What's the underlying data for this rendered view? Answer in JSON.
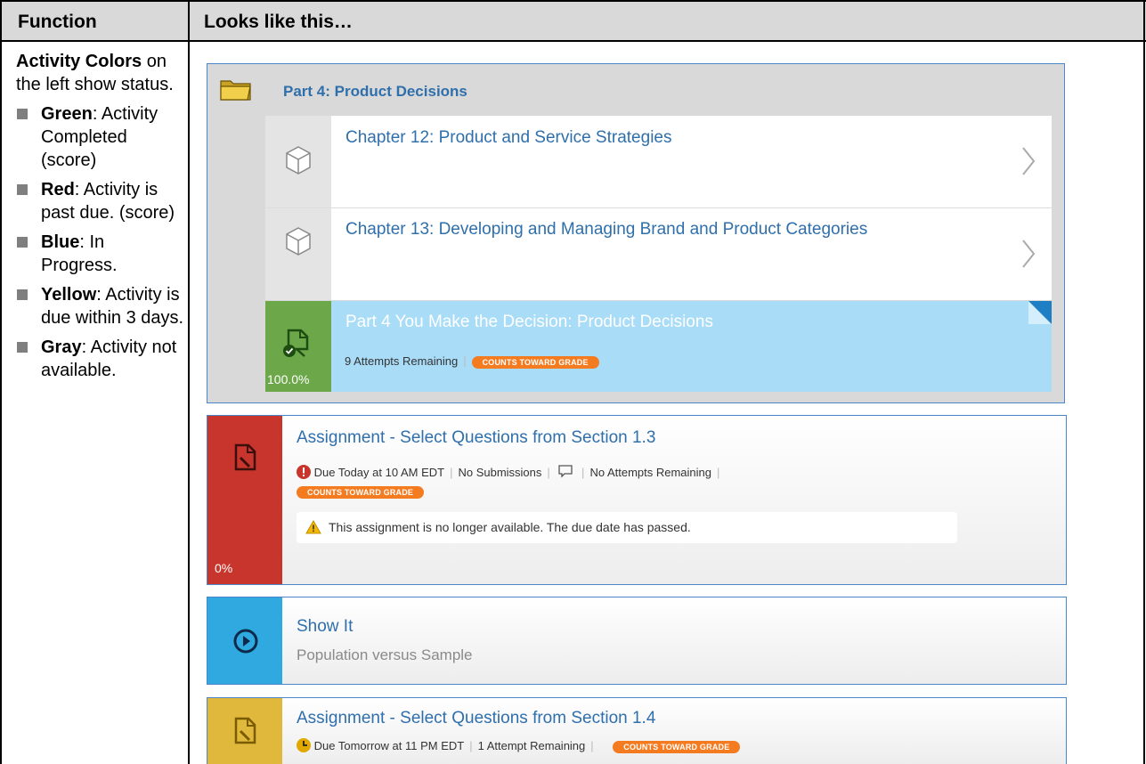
{
  "table": {
    "header_function": "Function",
    "header_looks": "Looks like this…"
  },
  "left": {
    "intro_bold": "Activity Colors",
    "intro_rest": " on the left show status.",
    "bullets": [
      {
        "color": "Green",
        "text": ": Activity Completed (score)"
      },
      {
        "color": "Red",
        "text": ": Activity is past due. (score)"
      },
      {
        "color": "Blue",
        "text": ": In Progress."
      },
      {
        "color": "Yellow",
        "text": ": Activity is due within 3 days."
      },
      {
        "color": "Gray",
        "text": ": Activity not available."
      }
    ]
  },
  "part": {
    "title": "Part 4: Product Decisions",
    "chapters": [
      "Chapter 12: Product and Service Strategies",
      "Chapter 13: Developing and Managing Brand and Product Categories"
    ],
    "activity": {
      "title": "Part 4 You Make the Decision: Product Decisions",
      "score": "100.0%",
      "attempts": "9 Attempts Remaining",
      "badge": "COUNTS TOWARD GRADE"
    }
  },
  "red_card": {
    "title": "Assignment - Select Questions from Section 1.3",
    "due": "Due Today at 10 AM EDT",
    "submissions": "No Submissions",
    "attempts": "No Attempts Remaining",
    "badge": "COUNTS TOWARD GRADE",
    "notice": "This assignment is no longer available. The due date has passed.",
    "score": "0%"
  },
  "blue_card": {
    "title": "Show It",
    "subtitle": "Population versus Sample"
  },
  "yellow_card": {
    "title": "Assignment - Select Questions from Section 1.4",
    "due": "Due Tomorrow at 11 PM EDT",
    "attempts": "1 Attempt Remaining",
    "badge": "COUNTS TOWARD GRADE"
  },
  "colors": {
    "green": "#6ca84a",
    "red": "#c8352c",
    "blue": "#2fa9e0",
    "yellow": "#e0b83c",
    "link": "#2f6fab",
    "badge": "#f47b20"
  }
}
